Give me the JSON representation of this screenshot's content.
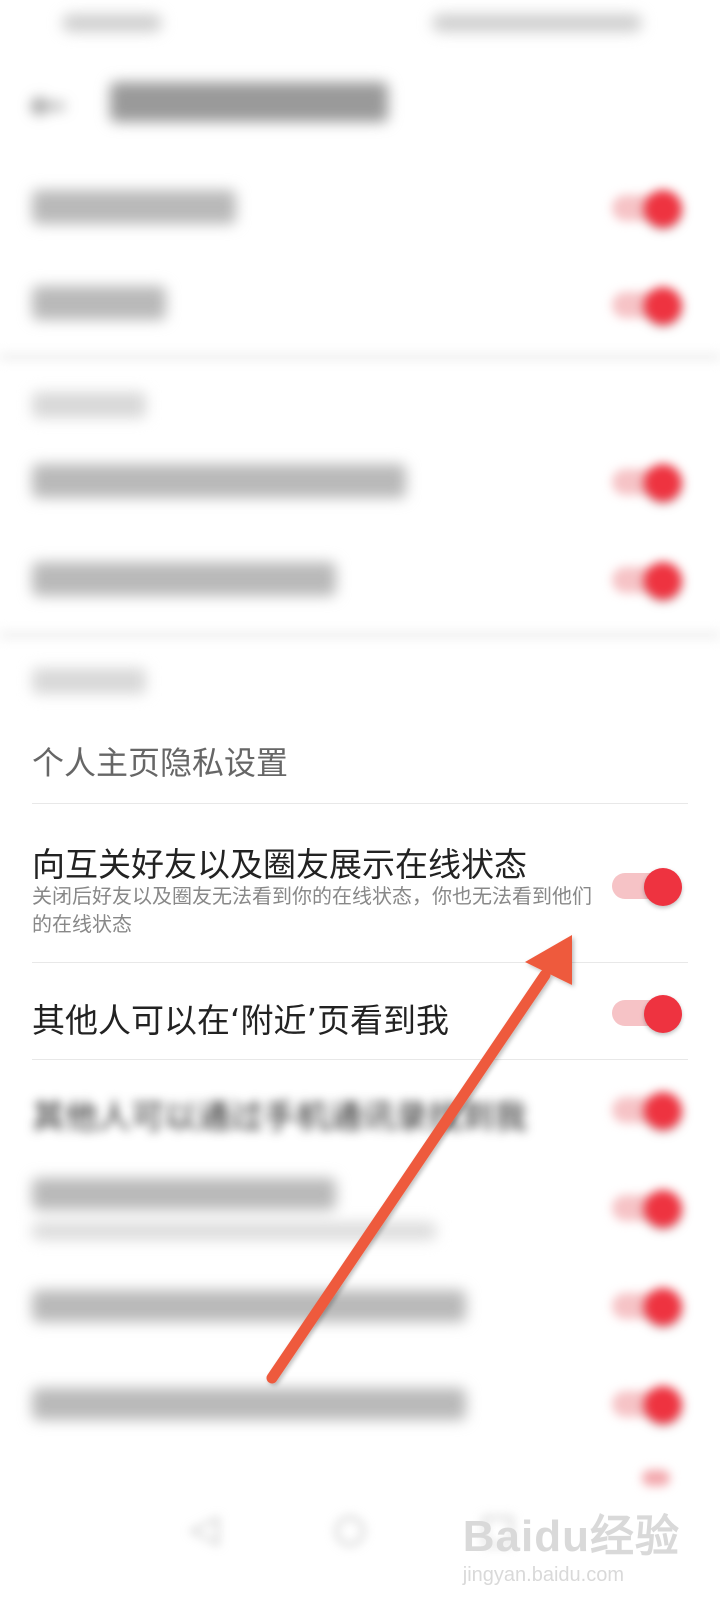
{
  "status_bar": {
    "left_text": "",
    "right_text": ""
  },
  "header": {
    "back_icon": "back-arrow-icon",
    "title": ""
  },
  "blurred_rows_top": [
    {
      "label": "",
      "on": true
    },
    {
      "label": "",
      "on": true
    }
  ],
  "section_2": {
    "label": "",
    "rows": [
      {
        "label": "",
        "on": true
      },
      {
        "label": "",
        "on": true
      }
    ]
  },
  "section_3": {
    "label": "",
    "subheading": "个人主页隐私设置",
    "rows": [
      {
        "label": "向互关好友以及圈友展示在线状态",
        "description": "关闭后好友以及圈友无法看到你的在线状态，你也无法看到他们的在线状态",
        "on": true
      },
      {
        "label": "其他人可以在‘附近’页看到我",
        "on": true
      }
    ]
  },
  "blurred_rows_bottom": [
    {
      "label": "其他人可以通过手机通讯录找到我",
      "on": true
    },
    {
      "label": "",
      "on": true
    },
    {
      "label": "",
      "on": true
    },
    {
      "label": "",
      "on": true
    }
  ],
  "nav_bar": {
    "icons": [
      "back-triangle-icon",
      "home-circle-icon",
      "recents-square-icon"
    ]
  },
  "watermark": {
    "main": "Baidu经验",
    "sub": "jingyan.baidu.com"
  },
  "colors": {
    "toggle_on": "#ee3340",
    "toggle_track": "#f6c3c6",
    "annotation_arrow": "#ee5a3c"
  }
}
